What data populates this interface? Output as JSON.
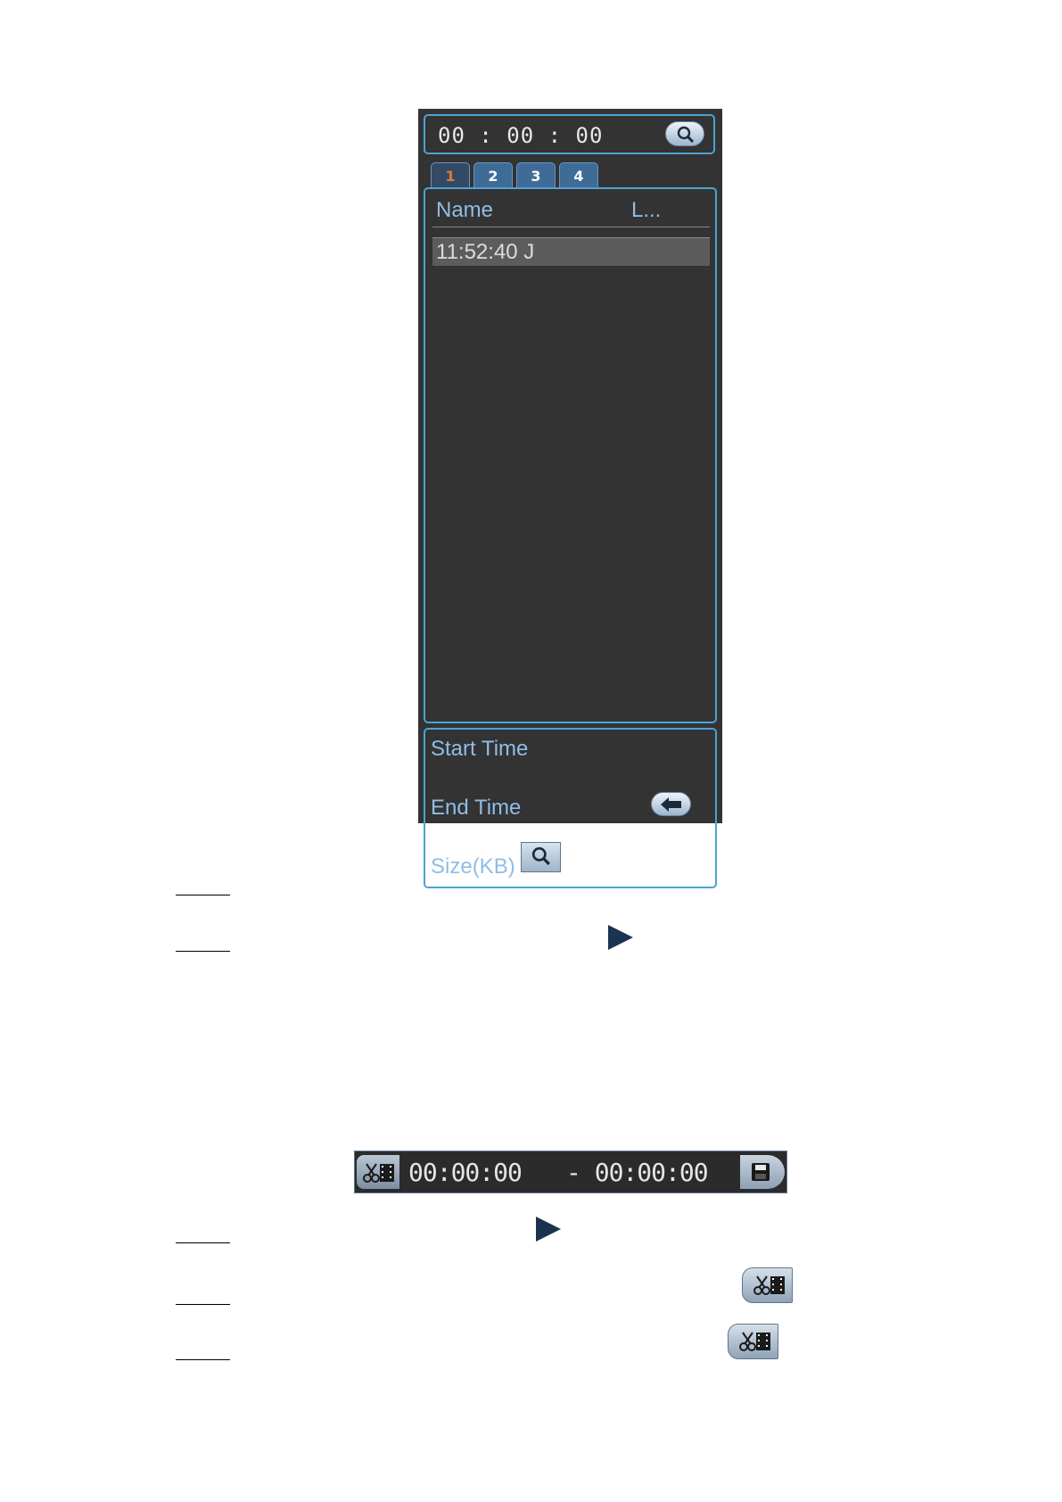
{
  "search_panel": {
    "time": "00 : 00 : 00",
    "search_icon": "magnifier-icon",
    "tabs": [
      "1",
      "2",
      "3",
      "4"
    ],
    "active_tab": "1",
    "list": {
      "columns": [
        "Name",
        "L..."
      ],
      "rows": [
        {
          "name": "11:52:40  J"
        }
      ]
    },
    "info": {
      "start_time_label": "Start Time",
      "end_time_label": "End Time",
      "size_label": "Size(KB)"
    },
    "back_icon": "back-arrow-icon"
  },
  "clip_bar": {
    "start": "00:00:00",
    "end": "- 00:00:00",
    "clip_icon": "scissors-film-icon",
    "save_icon": "floppy-disk-icon"
  },
  "colors": {
    "panel_bg": "#333333",
    "border": "#4ba3d6",
    "label": "#8fbde6",
    "active_tab": "#e07d2a"
  }
}
